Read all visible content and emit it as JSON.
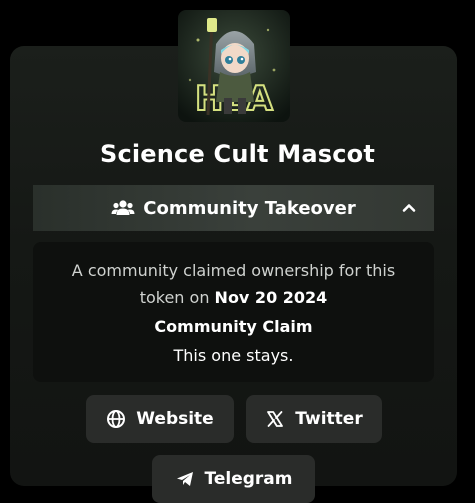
{
  "token": {
    "name": "Science Cult Mascot",
    "avatar_icon": "mascot-avatar-image",
    "avatar_text": "HEA"
  },
  "takeover": {
    "label": "Community Takeover",
    "icon": "users-icon",
    "toggle_icon": "chevron-up-icon",
    "expanded": true
  },
  "claim": {
    "line1": "A community claimed ownership for this",
    "line2_prefix": "token on ",
    "date": "Nov 20 2024",
    "heading": "Community Claim",
    "note": "This one stays."
  },
  "links": {
    "website": {
      "label": "Website",
      "icon": "globe-icon"
    },
    "twitter": {
      "label": "Twitter",
      "icon": "x-logo-icon"
    },
    "telegram": {
      "label": "Telegram",
      "icon": "telegram-icon"
    }
  },
  "colors": {
    "background": "#000000",
    "card": "#171a17",
    "takeover_bar": "#353a35",
    "panel": "#0e100e",
    "button": "#2a2c2a",
    "text": "#ffffff",
    "muted_text": "#cfd2cf"
  }
}
